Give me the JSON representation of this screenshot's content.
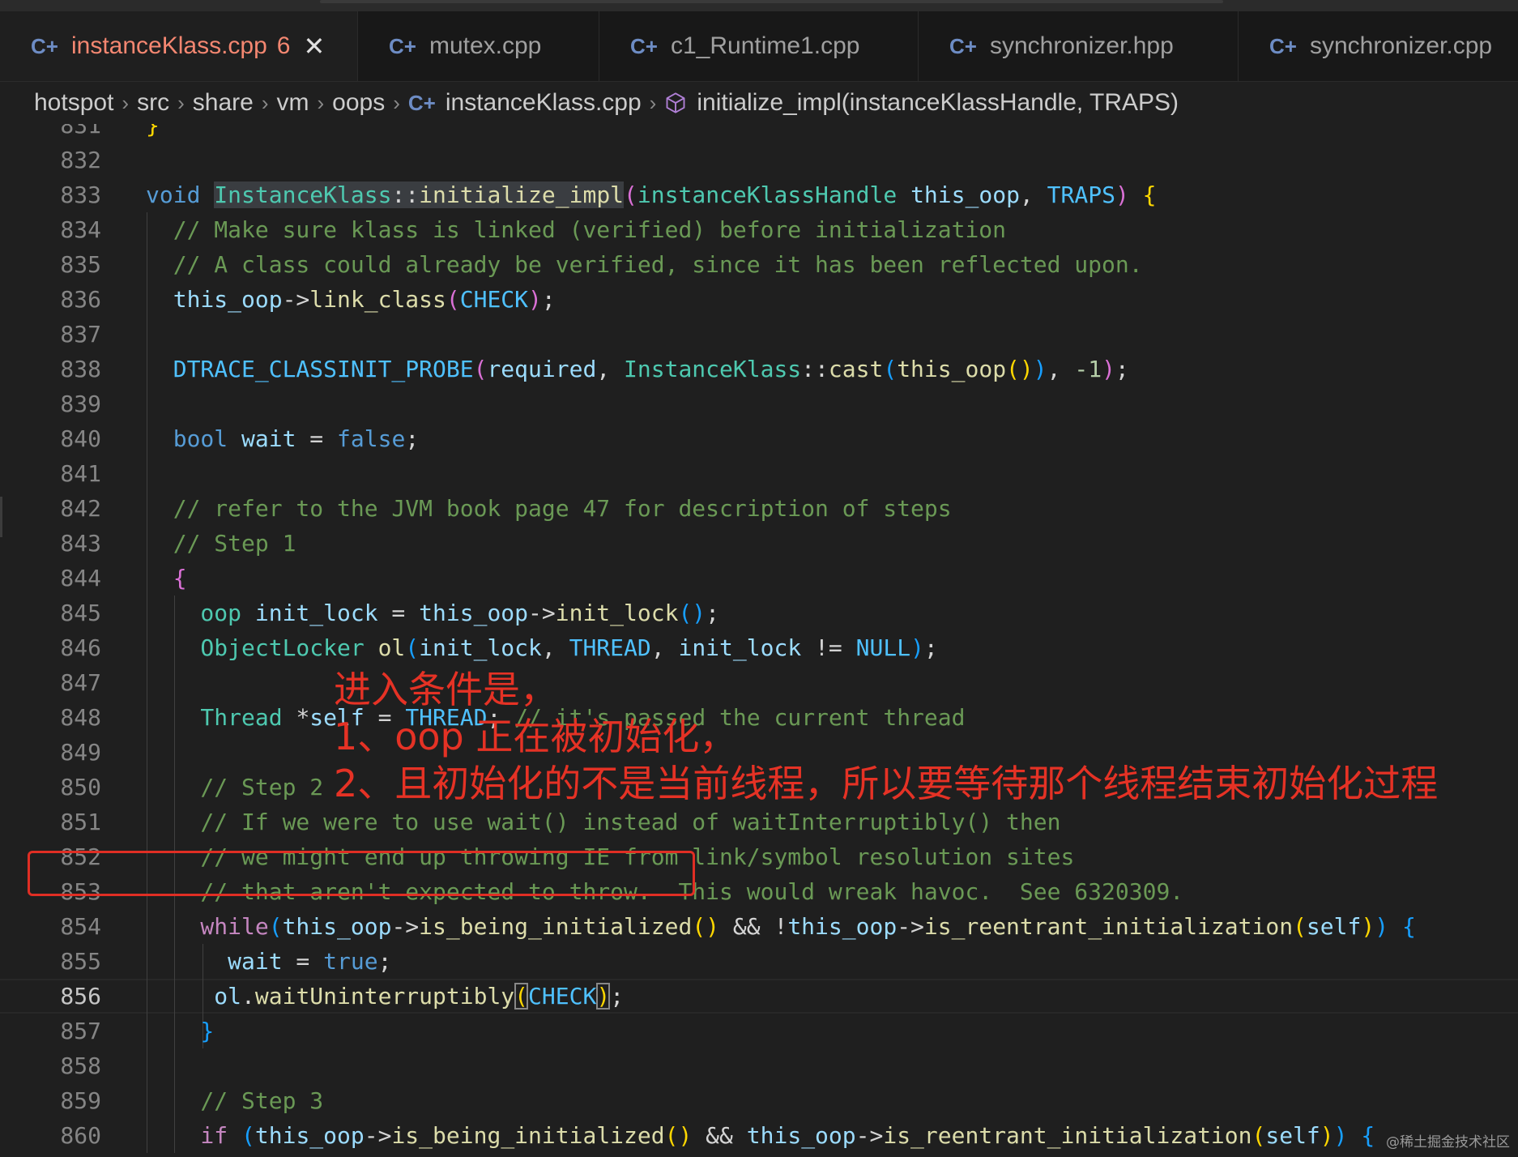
{
  "tabs": [
    {
      "label": "instanceKlass.cpp",
      "badge": "6",
      "icon": "cpp-file-icon",
      "active": true
    },
    {
      "label": "mutex.cpp",
      "icon": "cpp-file-icon"
    },
    {
      "label": "c1_Runtime1.cpp",
      "icon": "cpp-file-icon"
    },
    {
      "label": "synchronizer.hpp",
      "icon": "cpp-file-icon"
    },
    {
      "label": "synchronizer.cpp",
      "icon": "cpp-file-icon"
    }
  ],
  "tab_close_glyph": "✕",
  "breadcrumb": {
    "items": [
      "hotspot",
      "src",
      "share",
      "vm",
      "oops",
      "instanceKlass.cpp",
      "initialize_impl(instanceKlassHandle, TRAPS)"
    ],
    "separator": "›"
  },
  "editor": {
    "line_numbers": [
      "831",
      "832",
      "833",
      "834",
      "835",
      "836",
      "837",
      "838",
      "839",
      "840",
      "841",
      "842",
      "843",
      "844",
      "845",
      "846",
      "847",
      "848",
      "849",
      "850",
      "851",
      "852",
      "853",
      "854",
      "855",
      "856",
      "857",
      "858",
      "859",
      "860"
    ],
    "current_line": "856",
    "lines": [
      {
        "n": "831",
        "tokens": [
          {
            "t": "}",
            "c": "b1"
          }
        ]
      },
      {
        "n": "832",
        "tokens": []
      },
      {
        "n": "833",
        "tokens": [
          {
            "t": "void ",
            "c": "kw"
          },
          {
            "t": "InstanceKlass",
            "c": "ty hlw"
          },
          {
            "t": "::",
            "c": "op hlw"
          },
          {
            "t": "initialize_impl",
            "c": "fn hlw"
          },
          {
            "t": "(",
            "c": "b2"
          },
          {
            "t": "instanceKlassHandle ",
            "c": "ty"
          },
          {
            "t": "this_oop",
            "c": "va"
          },
          {
            "t": ", ",
            "c": "op"
          },
          {
            "t": "TRAPS",
            "c": "ma"
          },
          {
            "t": ") ",
            "c": "b2"
          },
          {
            "t": "{",
            "c": "b1"
          }
        ]
      },
      {
        "n": "834",
        "tokens": [
          {
            "t": "  // Make sure klass is linked (verified) before initialization",
            "c": "cm"
          }
        ]
      },
      {
        "n": "835",
        "tokens": [
          {
            "t": "  // A class could already be verified, since it has been reflected upon.",
            "c": "cm"
          }
        ]
      },
      {
        "n": "836",
        "tokens": [
          {
            "t": "  this_oop",
            "c": "va"
          },
          {
            "t": "->",
            "c": "op"
          },
          {
            "t": "link_class",
            "c": "fn"
          },
          {
            "t": "(",
            "c": "b2"
          },
          {
            "t": "CHECK",
            "c": "ma"
          },
          {
            "t": ")",
            "c": "b2"
          },
          {
            "t": ";",
            "c": "op"
          }
        ]
      },
      {
        "n": "837",
        "tokens": []
      },
      {
        "n": "838",
        "tokens": [
          {
            "t": "  DTRACE_CLASSINIT_PROBE",
            "c": "ma"
          },
          {
            "t": "(",
            "c": "b2"
          },
          {
            "t": "required",
            "c": "va"
          },
          {
            "t": ", ",
            "c": "op"
          },
          {
            "t": "InstanceKlass",
            "c": "ty"
          },
          {
            "t": "::",
            "c": "op"
          },
          {
            "t": "cast",
            "c": "fn"
          },
          {
            "t": "(",
            "c": "b3"
          },
          {
            "t": "this_oop",
            "c": "fn"
          },
          {
            "t": "()",
            "c": "b1"
          },
          {
            "t": ")",
            "c": "b3"
          },
          {
            "t": ", ",
            "c": "op"
          },
          {
            "t": "-1",
            "c": "nu"
          },
          {
            "t": ")",
            "c": "b2"
          },
          {
            "t": ";",
            "c": "op"
          }
        ]
      },
      {
        "n": "839",
        "tokens": []
      },
      {
        "n": "840",
        "tokens": [
          {
            "t": "  bool ",
            "c": "kw"
          },
          {
            "t": "wait",
            "c": "va"
          },
          {
            "t": " = ",
            "c": "op"
          },
          {
            "t": "false",
            "c": "kw"
          },
          {
            "t": ";",
            "c": "op"
          }
        ]
      },
      {
        "n": "841",
        "tokens": []
      },
      {
        "n": "842",
        "tokens": [
          {
            "t": "  // refer to the JVM book page 47 for description of steps",
            "c": "cm"
          }
        ]
      },
      {
        "n": "843",
        "tokens": [
          {
            "t": "  // Step 1",
            "c": "cm"
          }
        ]
      },
      {
        "n": "844",
        "tokens": [
          {
            "t": "  {",
            "c": "b2"
          }
        ]
      },
      {
        "n": "845",
        "tokens": [
          {
            "t": "    oop ",
            "c": "ty"
          },
          {
            "t": "init_lock",
            "c": "va"
          },
          {
            "t": " = ",
            "c": "op"
          },
          {
            "t": "this_oop",
            "c": "va"
          },
          {
            "t": "->",
            "c": "op"
          },
          {
            "t": "init_lock",
            "c": "fn"
          },
          {
            "t": "()",
            "c": "b3"
          },
          {
            "t": ";",
            "c": "op"
          }
        ]
      },
      {
        "n": "846",
        "tokens": [
          {
            "t": "    ObjectLocker ",
            "c": "ty"
          },
          {
            "t": "ol",
            "c": "fn"
          },
          {
            "t": "(",
            "c": "b3"
          },
          {
            "t": "init_lock",
            "c": "va"
          },
          {
            "t": ", ",
            "c": "op"
          },
          {
            "t": "THREAD",
            "c": "ma"
          },
          {
            "t": ", ",
            "c": "op"
          },
          {
            "t": "init_lock",
            "c": "va"
          },
          {
            "t": " != ",
            "c": "op"
          },
          {
            "t": "NULL",
            "c": "ma"
          },
          {
            "t": ")",
            "c": "b3"
          },
          {
            "t": ";",
            "c": "op"
          }
        ]
      },
      {
        "n": "847",
        "tokens": []
      },
      {
        "n": "848",
        "tokens": [
          {
            "t": "    Thread ",
            "c": "ty"
          },
          {
            "t": "*",
            "c": "op"
          },
          {
            "t": "self",
            "c": "va"
          },
          {
            "t": " = ",
            "c": "op"
          },
          {
            "t": "THREAD",
            "c": "ma"
          },
          {
            "t": "; ",
            "c": "op"
          },
          {
            "t": "// it's passed the current thread",
            "c": "cm"
          }
        ]
      },
      {
        "n": "849",
        "tokens": []
      },
      {
        "n": "850",
        "tokens": [
          {
            "t": "    // Step 2",
            "c": "cm"
          }
        ]
      },
      {
        "n": "851",
        "tokens": [
          {
            "t": "    // If we were to use wait() instead of waitInterruptibly() then",
            "c": "cm"
          }
        ]
      },
      {
        "n": "852",
        "tokens": [
          {
            "t": "    // we might end up throwing IE from link/symbol resolution sites",
            "c": "cm"
          }
        ]
      },
      {
        "n": "853",
        "tokens": [
          {
            "t": "    // that aren't expected to throw.  This would wreak havoc.  See 6320309.",
            "c": "cm"
          }
        ]
      },
      {
        "n": "854",
        "tokens": [
          {
            "t": "    while",
            "c": "ct"
          },
          {
            "t": "(",
            "c": "b3"
          },
          {
            "t": "this_oop",
            "c": "va"
          },
          {
            "t": "->",
            "c": "op"
          },
          {
            "t": "is_being_initialized",
            "c": "fn"
          },
          {
            "t": "()",
            "c": "b1"
          },
          {
            "t": " && !",
            "c": "op"
          },
          {
            "t": "this_oop",
            "c": "va"
          },
          {
            "t": "->",
            "c": "op"
          },
          {
            "t": "is_reentrant_initialization",
            "c": "fn"
          },
          {
            "t": "(",
            "c": "b1"
          },
          {
            "t": "self",
            "c": "va"
          },
          {
            "t": ")",
            "c": "b1"
          },
          {
            "t": ") ",
            "c": "b3"
          },
          {
            "t": "{",
            "c": "b3"
          }
        ]
      },
      {
        "n": "855",
        "tokens": [
          {
            "t": "      wait",
            "c": "va"
          },
          {
            "t": " = ",
            "c": "op"
          },
          {
            "t": "true",
            "c": "kw"
          },
          {
            "t": ";",
            "c": "op"
          }
        ]
      },
      {
        "n": "856",
        "tokens": [
          {
            "t": "     ol",
            "c": "va"
          },
          {
            "t": ".",
            "c": "op"
          },
          {
            "t": "waitUninterruptibly",
            "c": "fn"
          },
          {
            "t": "(",
            "c": "b1 bm"
          },
          {
            "t": "CHECK",
            "c": "ma"
          },
          {
            "t": ")",
            "c": "b1 bm"
          },
          {
            "t": ";",
            "c": "op"
          }
        ]
      },
      {
        "n": "857",
        "tokens": [
          {
            "t": "    }",
            "c": "b3"
          }
        ]
      },
      {
        "n": "858",
        "tokens": []
      },
      {
        "n": "859",
        "tokens": [
          {
            "t": "    // Step 3",
            "c": "cm"
          }
        ]
      },
      {
        "n": "860",
        "tokens": [
          {
            "t": "    if ",
            "c": "ct"
          },
          {
            "t": "(",
            "c": "b3"
          },
          {
            "t": "this_oop",
            "c": "va"
          },
          {
            "t": "->",
            "c": "op"
          },
          {
            "t": "is_being_initialized",
            "c": "fn"
          },
          {
            "t": "()",
            "c": "b1"
          },
          {
            "t": " && ",
            "c": "op"
          },
          {
            "t": "this_oop",
            "c": "va"
          },
          {
            "t": "->",
            "c": "op"
          },
          {
            "t": "is_reentrant_initialization",
            "c": "fn"
          },
          {
            "t": "(",
            "c": "b1"
          },
          {
            "t": "self",
            "c": "va"
          },
          {
            "t": ")",
            "c": "b1"
          },
          {
            "t": ") ",
            "c": "b3"
          },
          {
            "t": "{",
            "c": "b3"
          }
        ]
      }
    ]
  },
  "annotation": {
    "lines": [
      "进入条件是，",
      "1、oop 正在被初始化，",
      "2、且初始化的不是当前线程，所以要等待那个线程结束初始化过程"
    ],
    "color": "#e53225"
  },
  "watermark": "@稀土掘金技术社区",
  "colors": {
    "active_tab_text": "#f48771",
    "highlight_box": "#e02e24",
    "comment": "#6a9955",
    "keyword": "#569cd6",
    "type": "#4ec9b0",
    "function": "#dcdcaa"
  }
}
